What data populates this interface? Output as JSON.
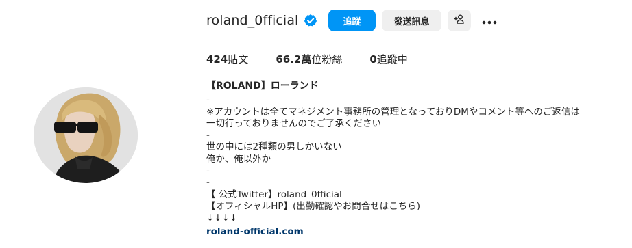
{
  "profile": {
    "username": "roland_0fficial",
    "verified_icon": "verified-badge-icon",
    "accent_color": "#0095f6",
    "link_color": "#00376b"
  },
  "actions": {
    "follow_label": "追蹤",
    "message_label": "發送訊息",
    "suggest_icon": "add-person-icon",
    "more_icon": "more-options-icon"
  },
  "stats": {
    "posts_count": "424",
    "posts_label": "貼文",
    "followers_count": "66.2萬",
    "followers_label": "位粉絲",
    "following_count": "0",
    "following_label": "追蹤中"
  },
  "bio": {
    "name": "【ROLAND】ローランド",
    "lines": [
      "-",
      "※アカウントは全てマネジメント事務所の管理となっておりDMやコメント等へのご返信は",
      "一切行っておりませんのでご了承ください",
      "-",
      "世の中には2種類の男しかいない",
      "俺か、俺以外か",
      "-",
      "-",
      "【 公式Twitter】roland_0fficial",
      "【オフィシャルHP】(出勤確認やお問合せはこちら)",
      "↓↓↓↓"
    ],
    "link": "roland-official.com"
  }
}
